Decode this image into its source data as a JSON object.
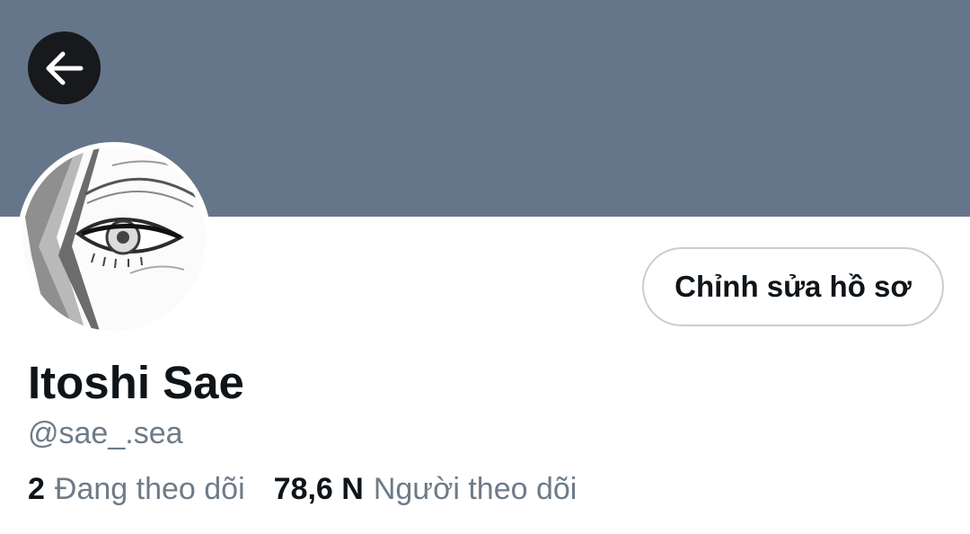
{
  "header": {
    "banner_color": "#66768a",
    "back_icon": "arrow-left-icon"
  },
  "profile": {
    "avatar": "manga-eye-portrait",
    "display_name": "Itoshi Sae",
    "handle": "@sae_.sea",
    "edit_button_label": "Chỉnh sửa hồ sơ"
  },
  "stats": {
    "following_count": "2",
    "following_label": "Đang theo dõi",
    "followers_count": "78,6 N",
    "followers_label": "Người theo dõi"
  },
  "colors": {
    "text_primary": "#0f1419",
    "text_secondary": "#6e7b88",
    "back_button_bg": "#17191c"
  }
}
